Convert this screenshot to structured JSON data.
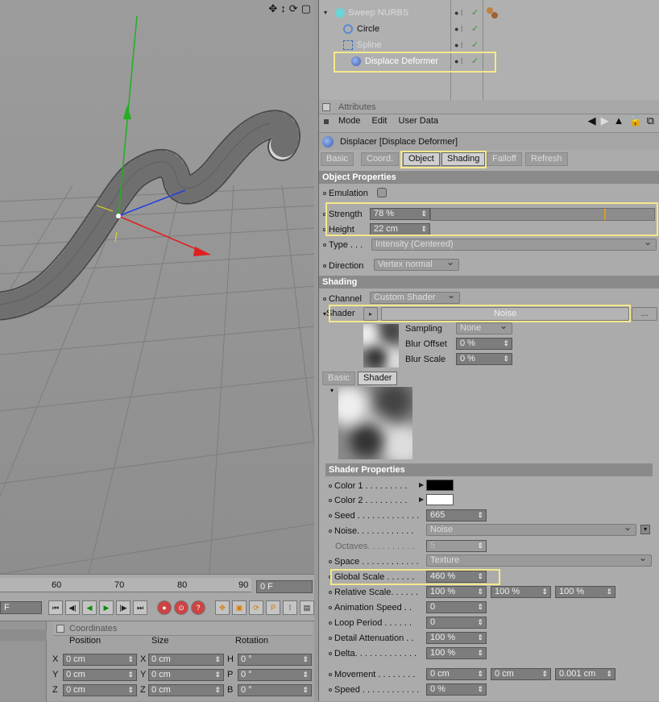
{
  "object_manager": {
    "objects": [
      {
        "name": "Sweep NURBS",
        "dim": true
      },
      {
        "name": "Circle",
        "dim": false
      },
      {
        "name": "Spline",
        "dim": true
      },
      {
        "name": "Displace Deformer",
        "dim": false
      }
    ]
  },
  "attributes": {
    "panel_title": "Attributes",
    "menu": [
      "Mode",
      "Edit",
      "User Data"
    ],
    "object_title": "Displacer [Displace Deformer]",
    "tabs": [
      "Basic",
      "Coord.",
      "Object",
      "Shading",
      "Falloff",
      "Refresh"
    ],
    "active_tabs": [
      "Object",
      "Shading"
    ],
    "object_properties": {
      "section": "Object Properties",
      "emulation_label": "Emulation",
      "strength_label": "Strength",
      "strength_value": "78 %",
      "strength_fraction": 0.78,
      "height_label": "Height",
      "height_value": "22 cm",
      "type_label": "Type . . .",
      "type_value": "Intensity (Centered)",
      "direction_label": "Direction",
      "direction_value": "Vertex normal"
    },
    "shading": {
      "section": "Shading",
      "channel_label": "Channel",
      "channel_value": "Custom Shader",
      "shader_label": "Shader",
      "shader_value": "Noise",
      "more_label": "...",
      "sampling_label": "Sampling",
      "sampling_value": "None",
      "blur_offset_label": "Blur Offset",
      "blur_offset_value": "0 %",
      "blur_scale_label": "Blur Scale",
      "blur_scale_value": "0 %",
      "sub_tabs": [
        "Basic",
        "Shader"
      ]
    },
    "shader_properties": {
      "section": "Shader Properties",
      "color1_label": "Color 1 . . . . . . . . .",
      "color1": "#000000",
      "color2_label": "Color 2 . . . . . . . . .",
      "color2": "#ffffff",
      "seed_label": "Seed . . . . . . . . . . . . .",
      "seed_value": "665",
      "noise_label": "Noise. . . . . . . . . . . .",
      "noise_value": "Noise",
      "octaves_label": "Octaves. . . . . . . . . .",
      "octaves_value": "5",
      "space_label": "Space . . . . . . . . . . . .",
      "space_value": "Texture",
      "global_scale_label": "Global Scale . . . . . .",
      "global_scale_value": "460 %",
      "relative_scale_label": "Relative Scale. . . . . .",
      "relative_scale_values": [
        "100 %",
        "100 %",
        "100 %"
      ],
      "animation_speed_label": "Animation Speed . .",
      "animation_speed_value": "0",
      "loop_period_label": "Loop Period . . . . . .",
      "loop_period_value": "0",
      "detail_attenuation_label": "Detail Attenuation . .",
      "detail_attenuation_value": "100 %",
      "delta_label": "Delta. . . . . . . . . . . . .",
      "delta_value": "100 %",
      "movement_label": "Movement . . . . . . . .",
      "movement_values": [
        "0 cm",
        "0 cm",
        "0.001 cm"
      ],
      "speed_label": "Speed . . . . . . . . . . . .",
      "speed_value": "0 %"
    }
  },
  "timeline": {
    "ticks": [
      "60",
      "70",
      "80",
      "90"
    ],
    "current_frame": "0 F",
    "left_frame": "F"
  },
  "coordinates": {
    "title": "Coordinates",
    "headers": [
      "Position",
      "Size",
      "Rotation"
    ],
    "rows": [
      {
        "axis_pos": "X",
        "pos": "0 cm",
        "axis_size": "X",
        "size": "0 cm",
        "axis_rot": "H",
        "rot": "0 °"
      },
      {
        "axis_pos": "Y",
        "pos": "0 cm",
        "axis_size": "Y",
        "size": "0 cm",
        "axis_rot": "P",
        "rot": "0 °"
      },
      {
        "axis_pos": "Z",
        "pos": "0 cm",
        "axis_size": "Z",
        "size": "0 cm",
        "axis_rot": "B",
        "rot": "0 °"
      }
    ]
  },
  "colors": {
    "highlight": "#f5e98a",
    "strength_marker": "#e39b1a",
    "axis_x": "#e02020",
    "axis_y": "#20b020",
    "axis_z": "#2040e0"
  }
}
